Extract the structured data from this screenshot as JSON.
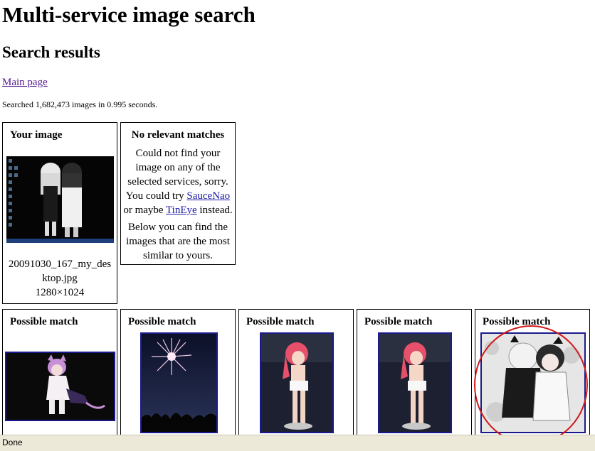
{
  "page_title": "Multi-service image search",
  "section_title": "Search results",
  "main_link": "Main page",
  "stats": "Searched 1,682,473 images in 0.995 seconds.",
  "your_image": {
    "title": "Your image",
    "filename_line1": "20091030_167_my_des",
    "filename_line2": "ktop.jpg",
    "dimensions": "1280×1024"
  },
  "no_matches": {
    "title": "No relevant matches",
    "lines": [
      "Could not find your",
      "image on any of the",
      "selected services, sorry."
    ],
    "try_prefix": "You could try ",
    "saucenao": "SauceNao",
    "maybe_prefix": "or maybe ",
    "tineye": "TinEye",
    "instead": " instead.",
    "below_lines": [
      "Below you can find the",
      "images that are the most",
      "similar to yours."
    ]
  },
  "matches": [
    {
      "title": "Possible match"
    },
    {
      "title": "Possible match"
    },
    {
      "title": "Possible match"
    },
    {
      "title": "Possible match"
    },
    {
      "title": "Possible match"
    }
  ],
  "status": "Done",
  "colors": {
    "thumb_border": "#1a1a8c",
    "annotation_circle": "#d01818",
    "statusbar": "#ece9d8"
  }
}
